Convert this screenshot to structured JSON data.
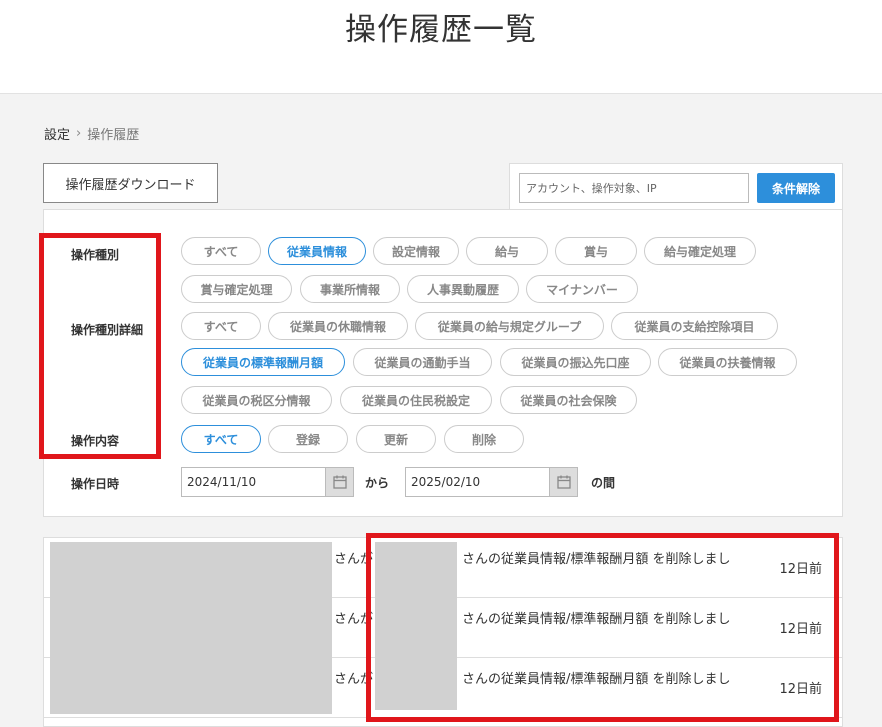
{
  "page_title": "操作履歴一覧",
  "breadcrumb": {
    "parent": "設定",
    "separator": "›",
    "current": "操作履歴"
  },
  "download_label": "操作履歴ダウンロード",
  "search": {
    "placeholder": "アカウント、操作対象、IP",
    "value": ""
  },
  "clear_label": "条件解除",
  "labels": {
    "op_type": "操作種別",
    "op_type_detail": "操作種別詳細",
    "op_content": "操作内容",
    "op_date": "操作日時"
  },
  "op_types": [
    "すべて",
    "従業員情報",
    "設定情報",
    "給与",
    "賞与",
    "給与確定処理",
    "賞与確定処理",
    "事業所情報",
    "人事異動履歴",
    "マイナンバー"
  ],
  "op_type_details": [
    "すべて",
    "従業員の休職情報",
    "従業員の給与規定グループ",
    "従業員の支給控除項目",
    "従業員の標準報酬月額",
    "従業員の通勤手当",
    "従業員の振込先口座",
    "従業員の扶養情報",
    "従業員の税区分情報",
    "従業員の住民税設定",
    "従業員の社会保険"
  ],
  "op_contents": [
    "すべて",
    "登録",
    "更新",
    "削除"
  ],
  "date": {
    "from": "2024/11/10",
    "from_sep": "から",
    "to": "2025/02/10",
    "suffix": "の間"
  },
  "rows": [
    {
      "actor_suffix": "さんが",
      "message": "さんの従業員情報/標準報酬月額 を削除しまし",
      "time": "12日前"
    },
    {
      "actor_suffix": "さんが",
      "message": "さんの従業員情報/標準報酬月額 を削除しまし",
      "time": "12日前"
    },
    {
      "actor_suffix": "さんが",
      "message": "さんの従業員情報/標準報酬月額 を削除しまし",
      "time": "12日前"
    }
  ],
  "colors": {
    "accent": "#2d8fdb",
    "highlight": "#e0161b",
    "mask": "#d1d1d1"
  }
}
